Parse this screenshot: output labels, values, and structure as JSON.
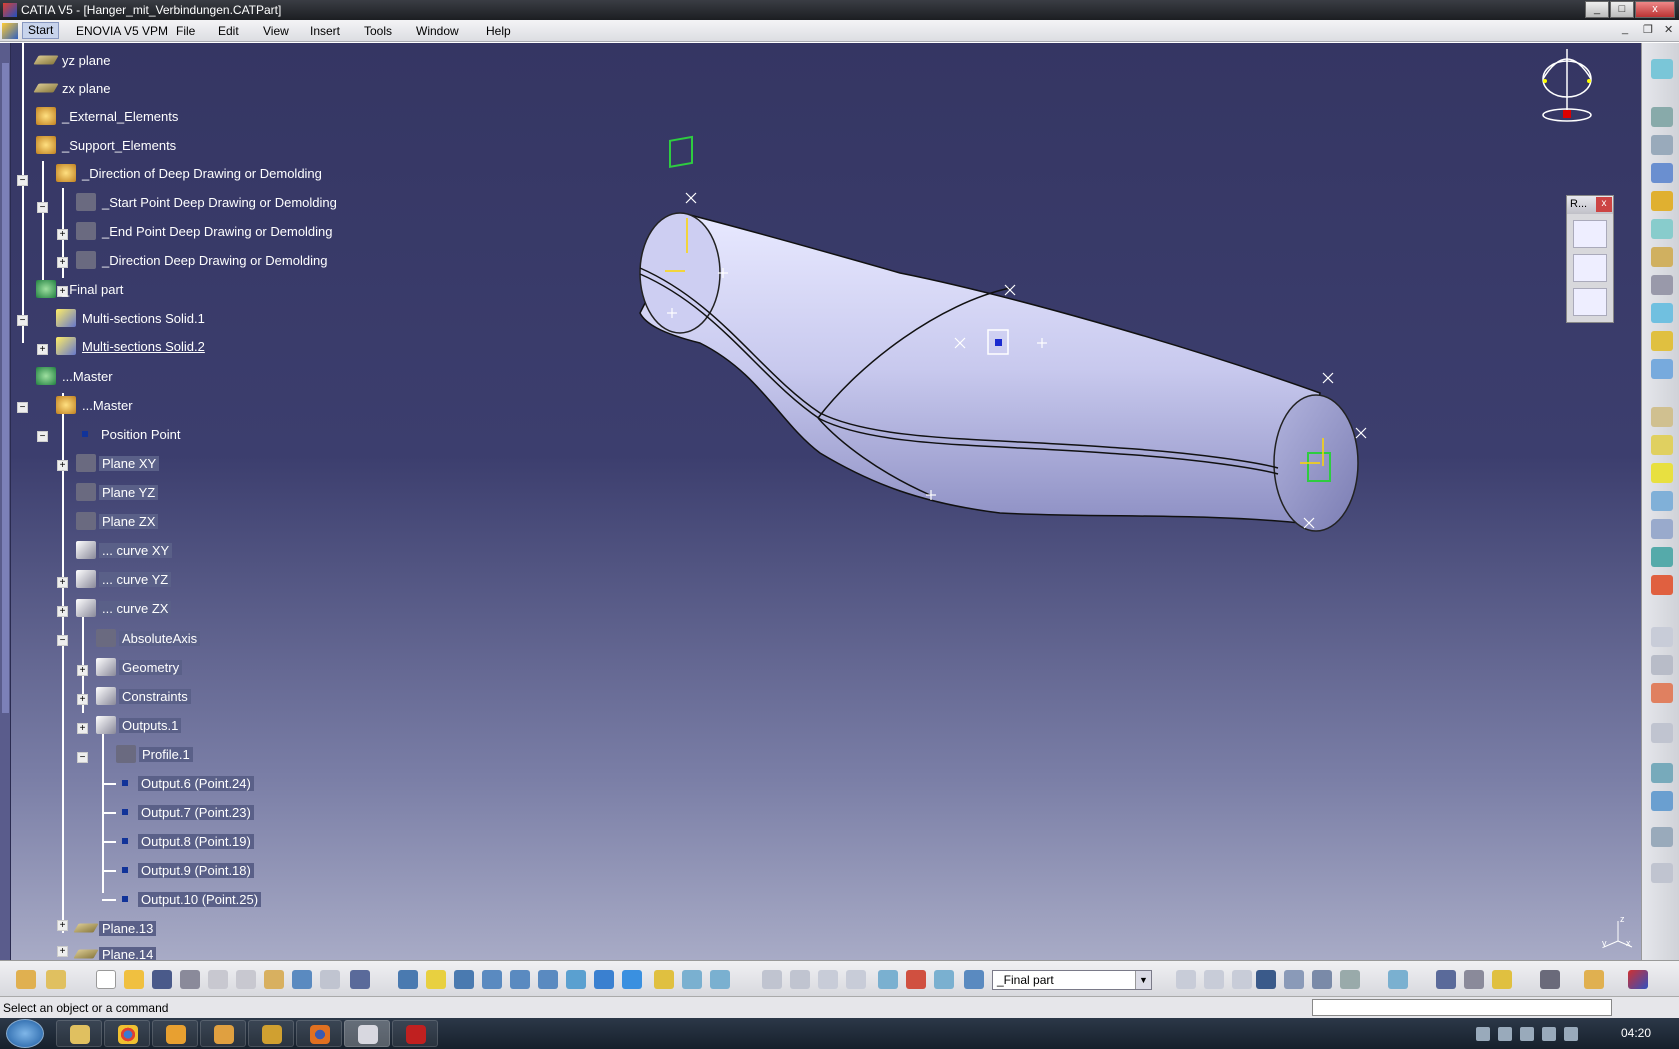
{
  "window": {
    "title": "CATIA V5 - [Hanger_mit_Verbindungen.CATPart]",
    "buttons": {
      "minimize": "_",
      "maximize": "□",
      "close": "x"
    }
  },
  "menu": {
    "start": "Start",
    "items": [
      "ENOVIA V5 VPM",
      "File",
      "Edit",
      "View",
      "Insert",
      "Tools",
      "Window",
      "Help"
    ]
  },
  "tree": {
    "items": [
      {
        "label": "yz plane"
      },
      {
        "label": "zx plane"
      },
      {
        "label": "_External_Elements"
      },
      {
        "label": "_Support_Elements"
      },
      {
        "label": "_Direction of Deep Drawing or Demolding"
      },
      {
        "label": "_Start Point Deep Drawing or Demolding"
      },
      {
        "label": "_End Point Deep Drawing or Demolding"
      },
      {
        "label": "_Direction Deep Drawing or Demolding"
      },
      {
        "label": "_Final part"
      },
      {
        "label": "Multi-sections Solid.1"
      },
      {
        "label": "Multi-sections Solid.2"
      },
      {
        "label": "...Master"
      },
      {
        "label": "...Master"
      },
      {
        "label": "Position Point"
      },
      {
        "label": "Plane XY"
      },
      {
        "label": "Plane YZ"
      },
      {
        "label": "Plane ZX"
      },
      {
        "label": "... curve XY"
      },
      {
        "label": "... curve YZ"
      },
      {
        "label": "... curve ZX"
      },
      {
        "label": "AbsoluteAxis"
      },
      {
        "label": "Geometry"
      },
      {
        "label": "Constraints"
      },
      {
        "label": "Outputs.1"
      },
      {
        "label": "Profile.1"
      },
      {
        "label": "Output.6 (Point.24)"
      },
      {
        "label": "Output.7 (Point.23)"
      },
      {
        "label": "Output.8 (Point.19)"
      },
      {
        "label": "Output.9 (Point.18)"
      },
      {
        "label": "Output.10 (Point.25)"
      },
      {
        "label": "Plane.13"
      },
      {
        "label": "Plane.14"
      }
    ]
  },
  "floating_toolbar": {
    "title": "R...",
    "close": "x"
  },
  "part_selector": {
    "value": "_Final part"
  },
  "status": {
    "message": "Select an object or a command"
  },
  "clock": "04:20",
  "icons": {
    "compass": "compass-icon",
    "axis": "axis-triad-icon",
    "catia_logo": "catia-logo-icon"
  },
  "colors": {
    "background_top": "#353663",
    "background_bottom": "#a8abc6",
    "part_surface": "#c8c9ee"
  }
}
